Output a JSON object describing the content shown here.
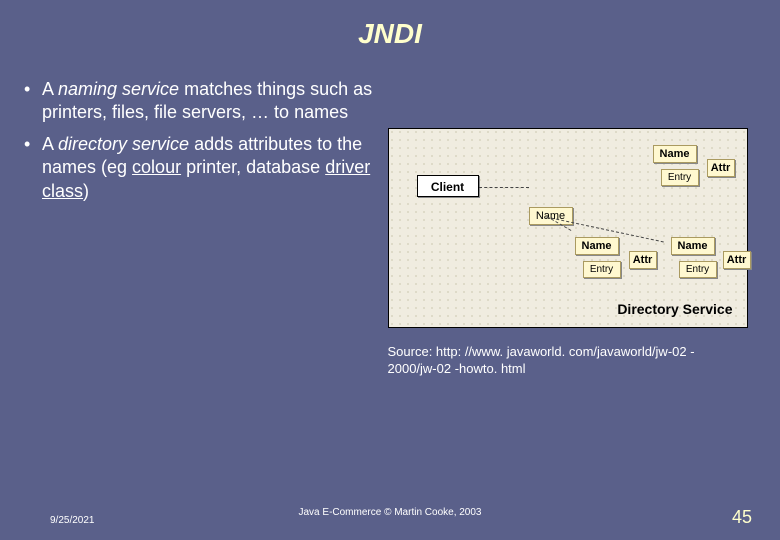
{
  "title": "JNDI",
  "bullets": {
    "item1_pre": "A ",
    "item1_term": "naming service",
    "item1_post": " matches things such as printers, files, file servers, … to names",
    "item2_pre": "A ",
    "item2_term": "directory service",
    "item2_mid": " adds attributes to the names (eg ",
    "item2_u1": "colour",
    "item2_mid2": " printer, database ",
    "item2_u2": "driver class",
    "item2_post": ")"
  },
  "diagram": {
    "client": "Client",
    "name": "Name",
    "entry": "Entry",
    "attr": "Attr",
    "service_label": "Directory Service"
  },
  "source_line1": "Source: http: //www. javaworld. com/javaworld/jw-02 -",
  "source_line2": "2000/jw-02 -howto. html",
  "footer": {
    "date": "9/25/2021",
    "center": "Java E-Commerce © Martin Cooke, 2003",
    "page": "45"
  }
}
